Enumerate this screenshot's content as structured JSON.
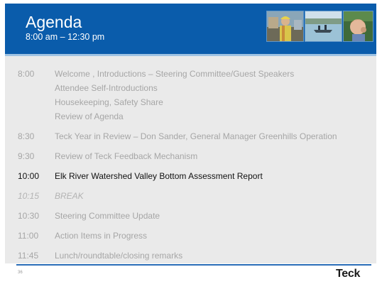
{
  "header": {
    "title": "Agenda",
    "subtitle": "8:00 am – 12:30 pm",
    "background_color": "#0a5cab"
  },
  "photos": [
    {
      "icon": "worker-photo"
    },
    {
      "icon": "boat-on-water-photo"
    },
    {
      "icon": "child-photo"
    }
  ],
  "agenda": [
    {
      "time": "8:00",
      "lines": [
        "Welcome , Introductions – Steering Committee/Guest Speakers",
        "Attendee Self-Introductions",
        "Housekeeping, Safety Share",
        "Review of Agenda"
      ],
      "state": "muted"
    },
    {
      "time": "8:30",
      "lines": [
        "Teck Year in Review – Don Sander, General Manager Greenhills Operation"
      ],
      "state": "muted"
    },
    {
      "time": "9:30",
      "lines": [
        "Review of Teck Feedback Mechanism"
      ],
      "state": "muted"
    },
    {
      "time": "10:00",
      "lines": [
        "Elk River Watershed Valley Bottom  Assessment Report"
      ],
      "state": "active"
    },
    {
      "time": "10:15",
      "lines": [
        "BREAK"
      ],
      "state": "italic"
    },
    {
      "time": "10:30",
      "lines": [
        "Steering Committee Update"
      ],
      "state": "muted"
    },
    {
      "time": "11:00",
      "lines": [
        "Action Items in Progress"
      ],
      "state": "muted"
    },
    {
      "time": "11:45",
      "lines": [
        "Lunch/roundtable/closing remarks"
      ],
      "state": "muted"
    }
  ],
  "footer": {
    "page_number": "36",
    "logo_text": "Teck",
    "rule_color": "#2a6db8"
  }
}
